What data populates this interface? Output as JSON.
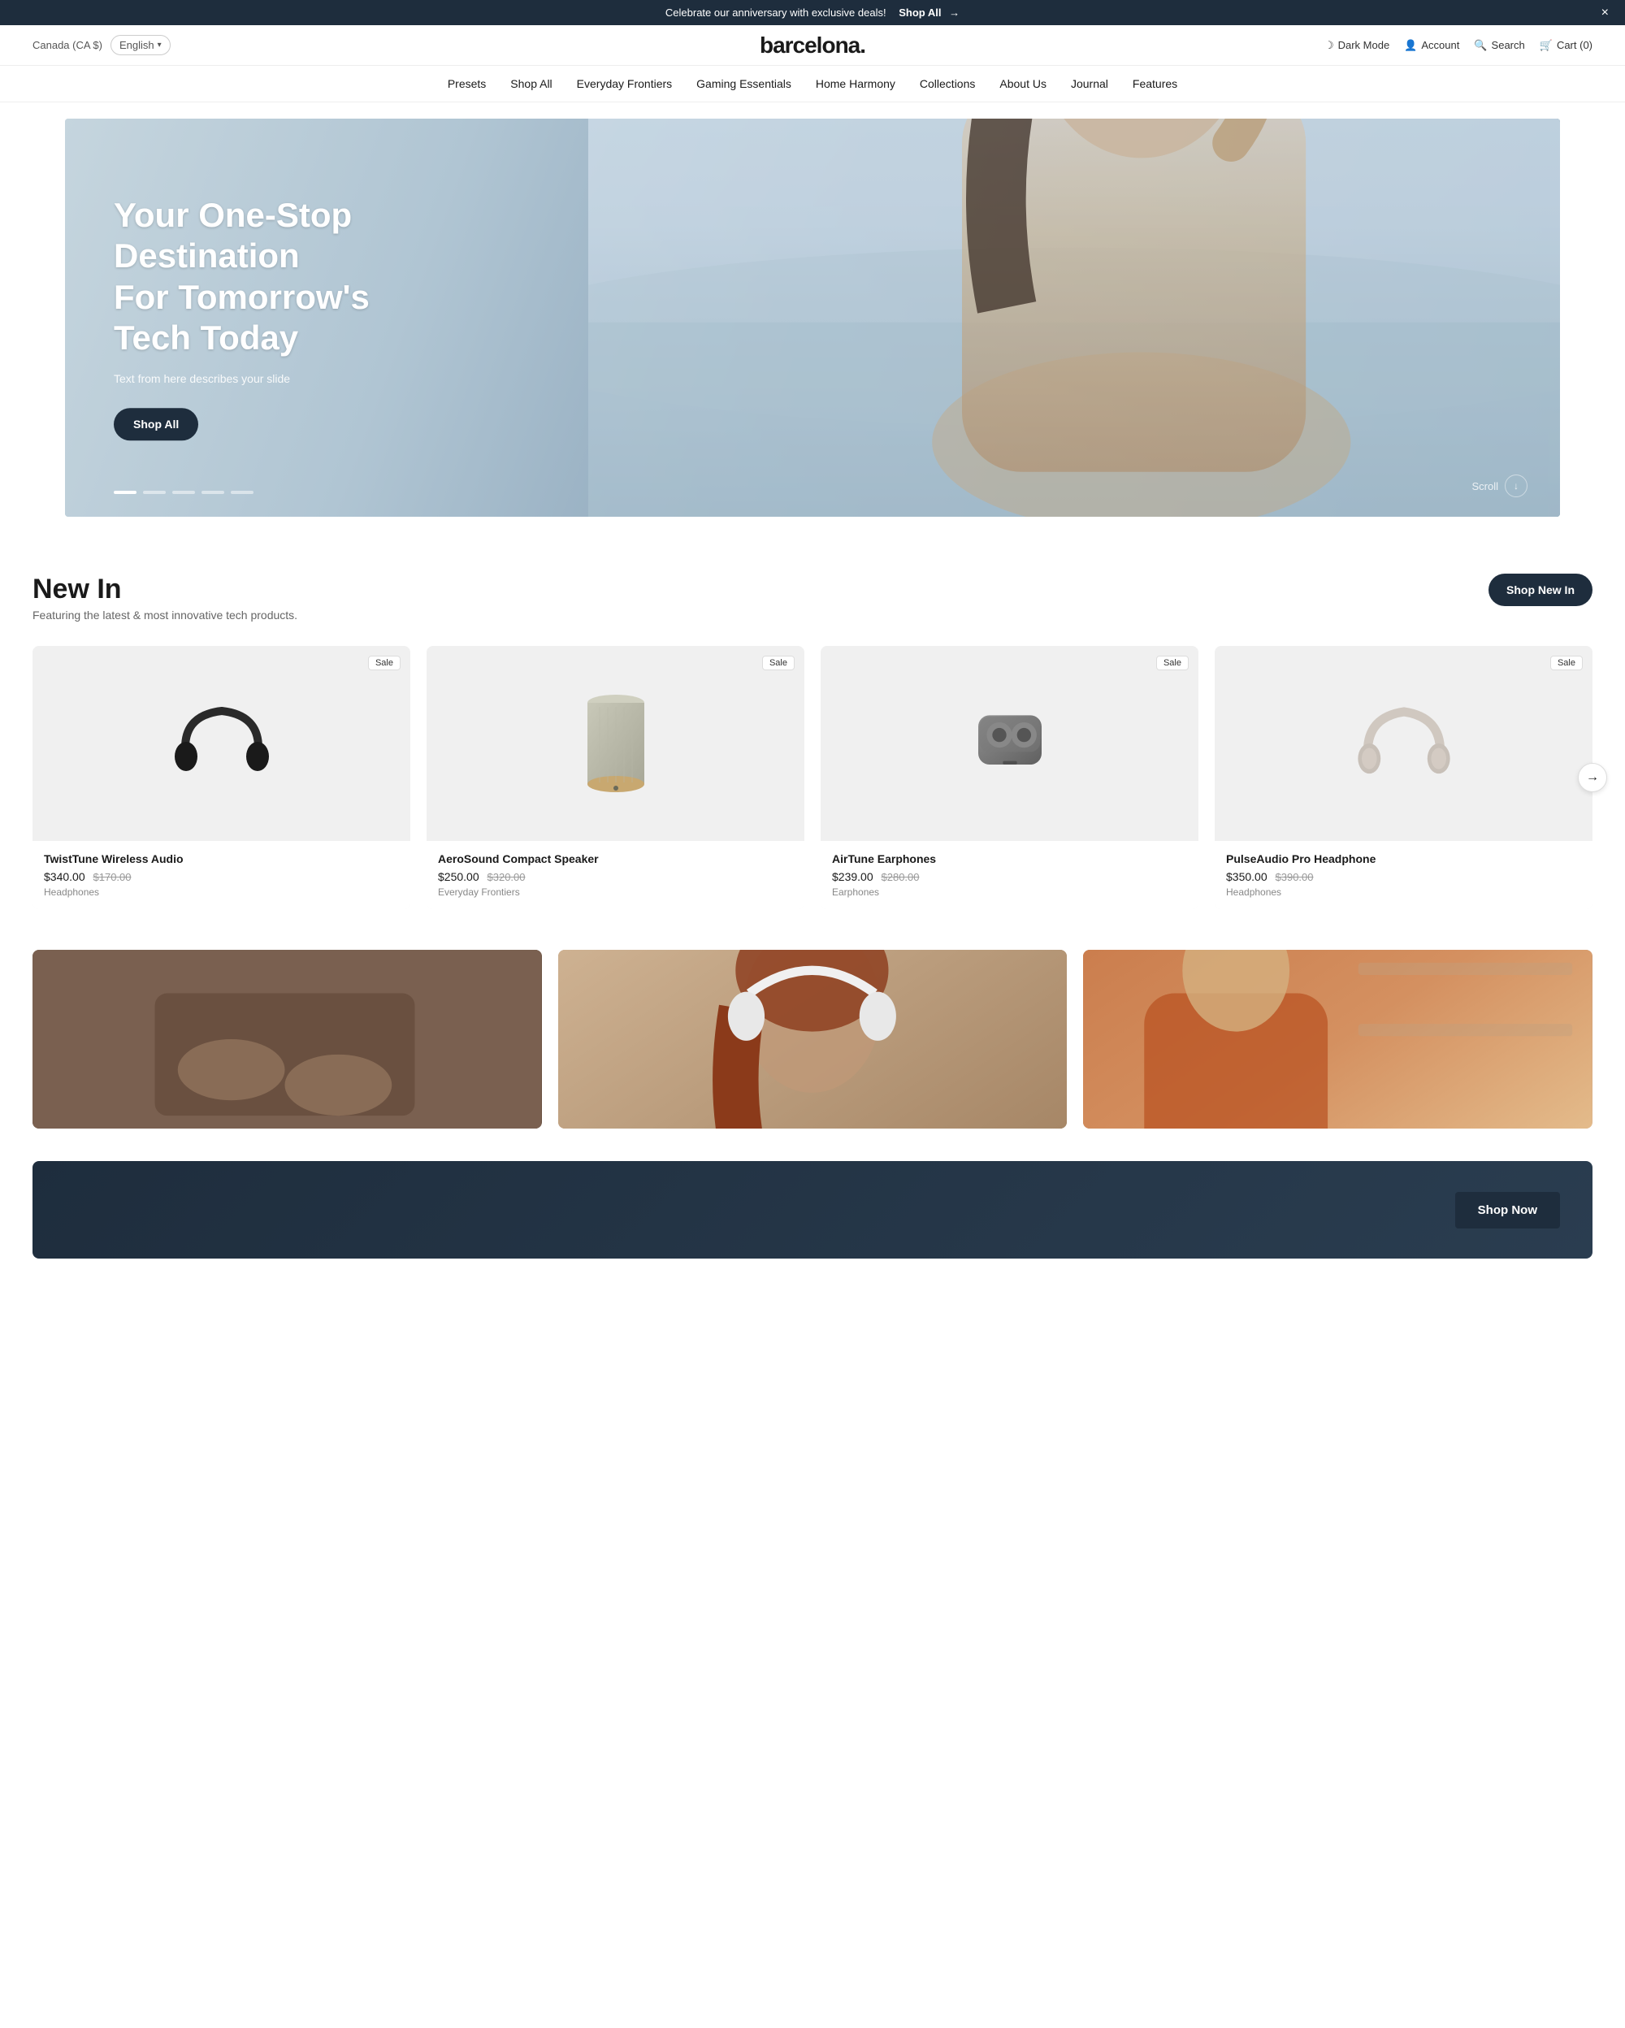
{
  "announcement": {
    "text": "Celebrate our anniversary with exclusive deals!",
    "link_text": "Shop All",
    "close_label": "×"
  },
  "header": {
    "locale": "Canada (CA $)",
    "language": "English",
    "logo": "barcelona.",
    "dark_mode_label": "Dark Mode",
    "account_label": "Account",
    "search_label": "Search",
    "cart_label": "Cart (0)"
  },
  "nav": {
    "items": [
      {
        "label": "Presets"
      },
      {
        "label": "Shop All"
      },
      {
        "label": "Everyday Frontiers"
      },
      {
        "label": "Gaming Essentials"
      },
      {
        "label": "Home Harmony"
      },
      {
        "label": "Collections"
      },
      {
        "label": "About Us"
      },
      {
        "label": "Journal"
      },
      {
        "label": "Features"
      }
    ]
  },
  "hero": {
    "heading_line1": "Your One-Stop Destination",
    "heading_line2": "For Tomorrow's Tech Today",
    "subtext": "Text from here describes your slide",
    "cta_label": "Shop All",
    "scroll_label": "Scroll",
    "dots": [
      true,
      false,
      false,
      false,
      false
    ]
  },
  "new_in": {
    "title": "New In",
    "subtitle": "Featuring the latest & most innovative tech products.",
    "cta_label": "Shop New In",
    "products": [
      {
        "name": "TwistTune Wireless Audio",
        "price": "$340.00",
        "original_price": "$170.00",
        "category": "Headphones",
        "badge": "Sale",
        "type": "headphones-dark"
      },
      {
        "name": "AeroSound Compact Speaker",
        "price": "$250.00",
        "original_price": "$320.00",
        "category": "Everyday Frontiers",
        "badge": "Sale",
        "type": "speaker"
      },
      {
        "name": "AirTune Earphones",
        "price": "$239.00",
        "original_price": "$280.00",
        "category": "Earphones",
        "badge": "Sale",
        "type": "earphones"
      },
      {
        "name": "PulseAudio Pro Headphone",
        "price": "$350.00",
        "original_price": "$390.00",
        "category": "Headphones",
        "badge": "Sale",
        "type": "headphones-light"
      }
    ]
  },
  "bottom_images": [
    {
      "alt": "Hands image",
      "class": "img-placeholder-1"
    },
    {
      "alt": "Woman with headphones",
      "class": "img-placeholder-2"
    },
    {
      "alt": "Woman working",
      "class": "img-placeholder-3"
    }
  ],
  "shop_now": {
    "label": "Shop Now"
  }
}
